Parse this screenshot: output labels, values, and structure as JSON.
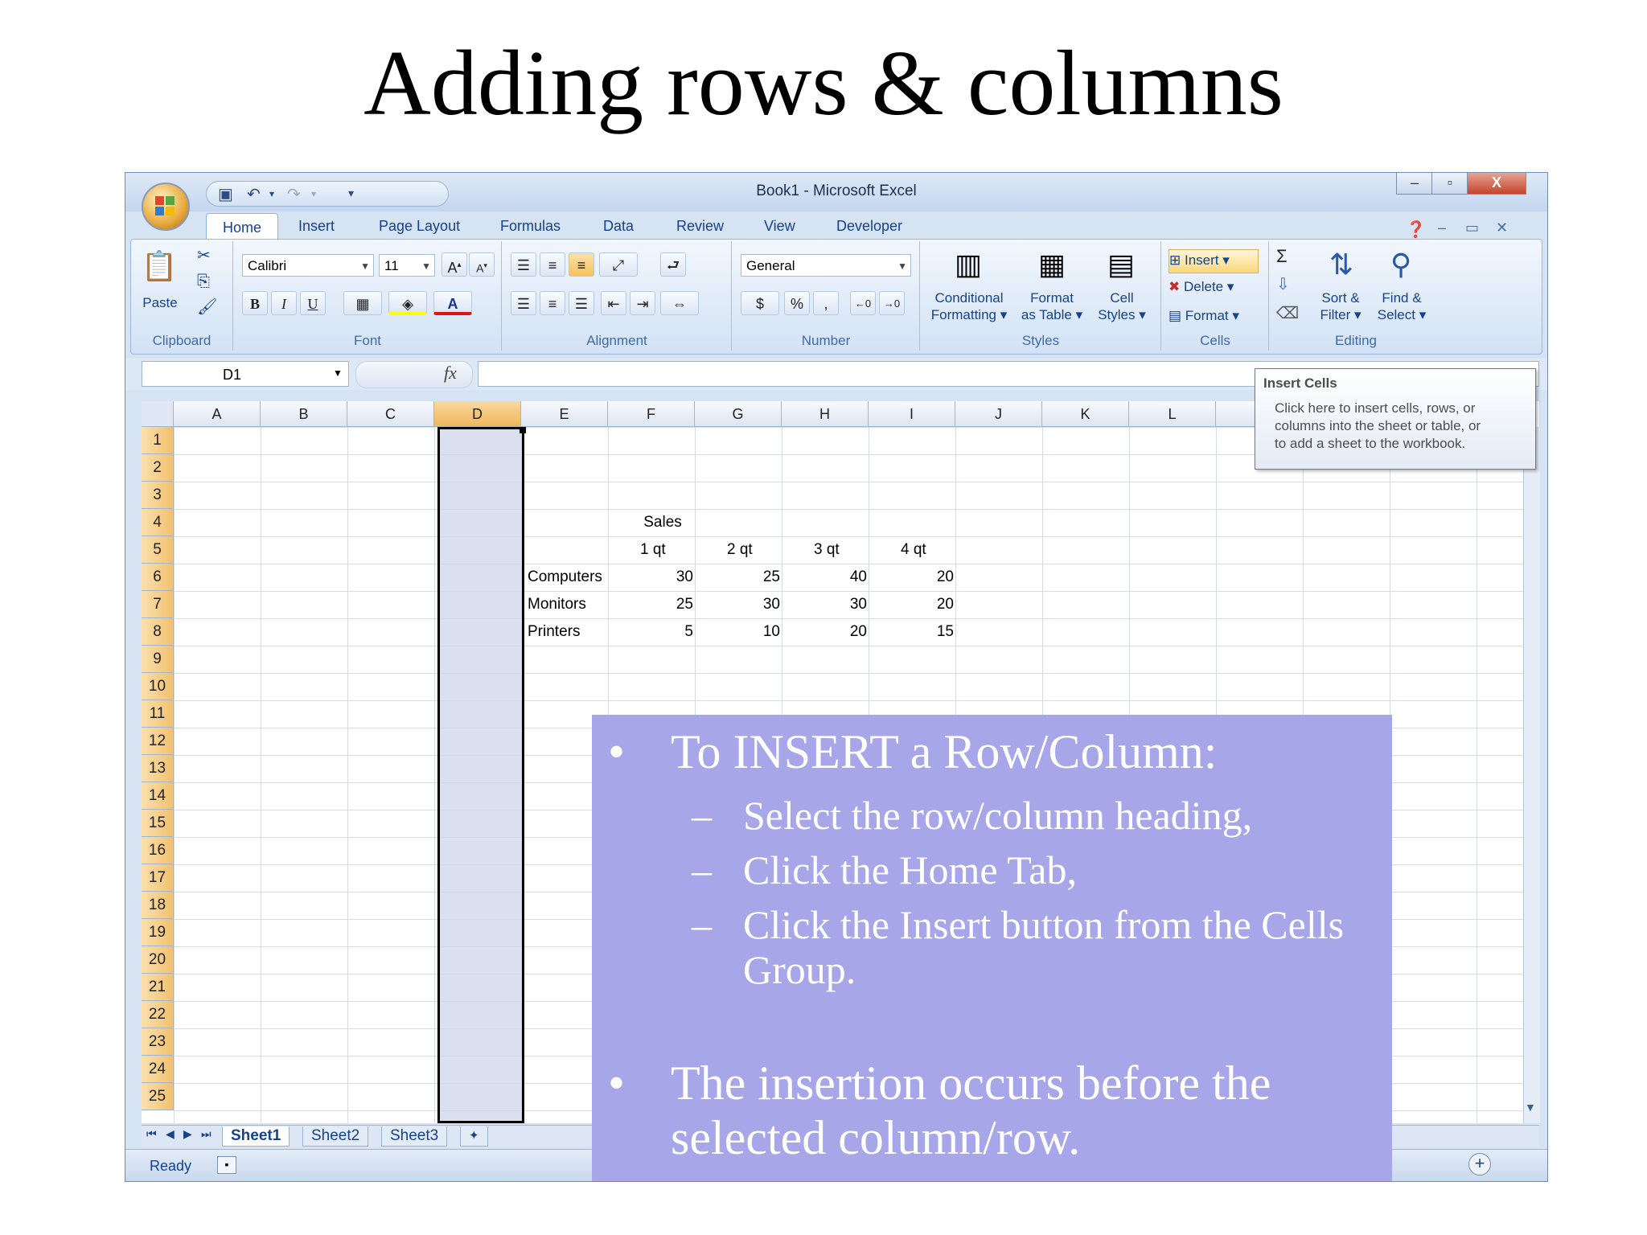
{
  "slide": {
    "title": "Adding rows & columns"
  },
  "window": {
    "title": "Book1 - Microsoft Excel",
    "controls": {
      "minimize": "–",
      "restore": "▫",
      "close": "X"
    }
  },
  "ribbon_tabs": [
    "Home",
    "Insert",
    "Page Layout",
    "Formulas",
    "Data",
    "Review",
    "View",
    "Developer"
  ],
  "ribbon": {
    "clipboard": {
      "paste": "Paste",
      "label": "Clipboard"
    },
    "font": {
      "name": "Calibri",
      "size": "11",
      "label": "Font",
      "bold": "B",
      "italic": "I",
      "underline": "U"
    },
    "alignment": {
      "label": "Alignment"
    },
    "number": {
      "format": "General",
      "currency": "$",
      "percent": "%",
      "comma": ",",
      "label": "Number"
    },
    "styles": {
      "conditional_1": "Conditional",
      "conditional_2": "Formatting",
      "format_1": "Format",
      "format_2": "as Table",
      "cell_1": "Cell",
      "cell_2": "Styles",
      "label": "Styles"
    },
    "cells": {
      "insert": "Insert",
      "delete": "Delete",
      "format": "Format",
      "label": "Cells"
    },
    "editing": {
      "sigma": "Σ",
      "sort_1": "Sort &",
      "sort_2": "Filter",
      "find_1": "Find &",
      "find_2": "Select",
      "label": "Editing"
    }
  },
  "formula_bar": {
    "name_box": "D1",
    "fx": "fx",
    "value": ""
  },
  "columns": [
    "A",
    "B",
    "C",
    "D",
    "E",
    "F",
    "G",
    "H",
    "I",
    "J",
    "K",
    "L"
  ],
  "selected_column": "D",
  "rows": [
    "1",
    "2",
    "3",
    "4",
    "5",
    "6",
    "7",
    "8",
    "9",
    "10",
    "11",
    "12",
    "13",
    "14",
    "15",
    "16",
    "17",
    "18",
    "19",
    "20",
    "21",
    "22",
    "23",
    "24",
    "25"
  ],
  "sheet": {
    "title": "Sales",
    "headers": [
      "1 qt",
      "2 qt",
      "3 qt",
      "4 qt"
    ],
    "rows": [
      {
        "label": "Computers",
        "values": [
          "30",
          "25",
          "40",
          "20"
        ]
      },
      {
        "label": "Monitors",
        "values": [
          "25",
          "30",
          "30",
          "20"
        ]
      },
      {
        "label": "Printers",
        "values": [
          "5",
          "10",
          "20",
          "15"
        ]
      }
    ]
  },
  "sheet_tabs": [
    "Sheet1",
    "Sheet2",
    "Sheet3"
  ],
  "status": {
    "ready": "Ready"
  },
  "tooltip": {
    "title": "Insert Cells",
    "line1": "Click here to insert cells, rows, or",
    "line2": "columns into the sheet or table, or",
    "line3": "to add a sheet to the workbook."
  },
  "overlay": {
    "bullet": "•",
    "dash": "–",
    "point1": "To INSERT a Row/Column:",
    "sub1": "Select the row/column heading,",
    "sub2": "Click the Home Tab,",
    "sub3_line1": "Click the Insert button from the Cells",
    "sub3_line2": "Group.",
    "point2_line1": "The insertion occurs before the",
    "point2_line2": "selected column/row."
  },
  "colors": {
    "overlay": "#a6a6e9",
    "selection": "#f0b55c",
    "ribbon_text": "#15428b"
  }
}
